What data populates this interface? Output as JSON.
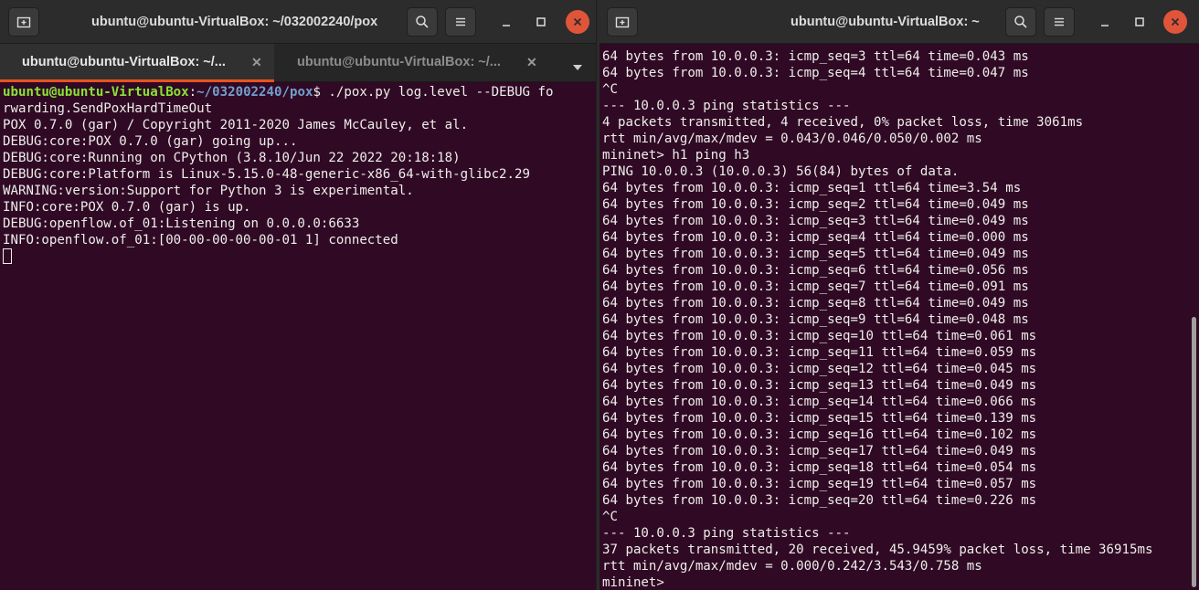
{
  "left_window": {
    "title": "ubuntu@ubuntu-VirtualBox: ~/032002240/pox",
    "tabs": [
      {
        "label": "ubuntu@ubuntu-VirtualBox: ~/..."
      },
      {
        "label": "ubuntu@ubuntu-VirtualBox: ~/..."
      }
    ],
    "prompt": {
      "user_host": "ubuntu@ubuntu-VirtualBox",
      "colon": ":",
      "path": "~/032002240/pox",
      "sign": "$",
      "command": " ./pox.py log.level --DEBUG fo"
    },
    "lines": [
      "rwarding.SendPoxHardTimeOut",
      "POX 0.7.0 (gar) / Copyright 2011-2020 James McCauley, et al.",
      "DEBUG:core:POX 0.7.0 (gar) going up...",
      "DEBUG:core:Running on CPython (3.8.10/Jun 22 2022 20:18:18)",
      "DEBUG:core:Platform is Linux-5.15.0-48-generic-x86_64-with-glibc2.29",
      "WARNING:version:Support for Python 3 is experimental.",
      "INFO:core:POX 0.7.0 (gar) is up.",
      "DEBUG:openflow.of_01:Listening on 0.0.0.0:6633",
      "INFO:openflow.of_01:[00-00-00-00-00-01 1] connected"
    ]
  },
  "right_window": {
    "title": "ubuntu@ubuntu-VirtualBox: ~",
    "lines": [
      "64 bytes from 10.0.0.3: icmp_seq=3 ttl=64 time=0.043 ms",
      "64 bytes from 10.0.0.3: icmp_seq=4 ttl=64 time=0.047 ms",
      "^C",
      "--- 10.0.0.3 ping statistics ---",
      "4 packets transmitted, 4 received, 0% packet loss, time 3061ms",
      "rtt min/avg/max/mdev = 0.043/0.046/0.050/0.002 ms",
      "mininet> h1 ping h3",
      "PING 10.0.0.3 (10.0.0.3) 56(84) bytes of data.",
      "64 bytes from 10.0.0.3: icmp_seq=1 ttl=64 time=3.54 ms",
      "64 bytes from 10.0.0.3: icmp_seq=2 ttl=64 time=0.049 ms",
      "64 bytes from 10.0.0.3: icmp_seq=3 ttl=64 time=0.049 ms",
      "64 bytes from 10.0.0.3: icmp_seq=4 ttl=64 time=0.000 ms",
      "64 bytes from 10.0.0.3: icmp_seq=5 ttl=64 time=0.049 ms",
      "64 bytes from 10.0.0.3: icmp_seq=6 ttl=64 time=0.056 ms",
      "64 bytes from 10.0.0.3: icmp_seq=7 ttl=64 time=0.091 ms",
      "64 bytes from 10.0.0.3: icmp_seq=8 ttl=64 time=0.049 ms",
      "64 bytes from 10.0.0.3: icmp_seq=9 ttl=64 time=0.048 ms",
      "64 bytes from 10.0.0.3: icmp_seq=10 ttl=64 time=0.061 ms",
      "64 bytes from 10.0.0.3: icmp_seq=11 ttl=64 time=0.059 ms",
      "64 bytes from 10.0.0.3: icmp_seq=12 ttl=64 time=0.045 ms",
      "64 bytes from 10.0.0.3: icmp_seq=13 ttl=64 time=0.049 ms",
      "64 bytes from 10.0.0.3: icmp_seq=14 ttl=64 time=0.066 ms",
      "64 bytes from 10.0.0.3: icmp_seq=15 ttl=64 time=0.139 ms",
      "64 bytes from 10.0.0.3: icmp_seq=16 ttl=64 time=0.102 ms",
      "64 bytes from 10.0.0.3: icmp_seq=17 ttl=64 time=0.049 ms",
      "64 bytes from 10.0.0.3: icmp_seq=18 ttl=64 time=0.054 ms",
      "64 bytes from 10.0.0.3: icmp_seq=19 ttl=64 time=0.057 ms",
      "64 bytes from 10.0.0.3: icmp_seq=20 ttl=64 time=0.226 ms",
      "^C",
      "--- 10.0.0.3 ping statistics ---",
      "37 packets transmitted, 20 received, 45.9459% packet loss, time 36915ms",
      "rtt min/avg/max/mdev = 0.000/0.242/3.543/0.758 ms",
      "mininet> "
    ]
  },
  "icons": {
    "new_tab": "new-tab-icon",
    "search": "search-icon",
    "menu": "hamburger-menu-icon",
    "minimize": "minimize-icon",
    "maximize": "maximize-icon",
    "close": "close-icon",
    "tab_close": "tab-close-icon",
    "tab_dropdown": "chevron-down-icon"
  },
  "colors": {
    "terminal_bg": "#300a24",
    "terminal_fg": "#eeeeec",
    "prompt_user": "#8ae234",
    "prompt_path": "#729fcf",
    "accent": "#e95420",
    "close_button": "#e0553a"
  }
}
